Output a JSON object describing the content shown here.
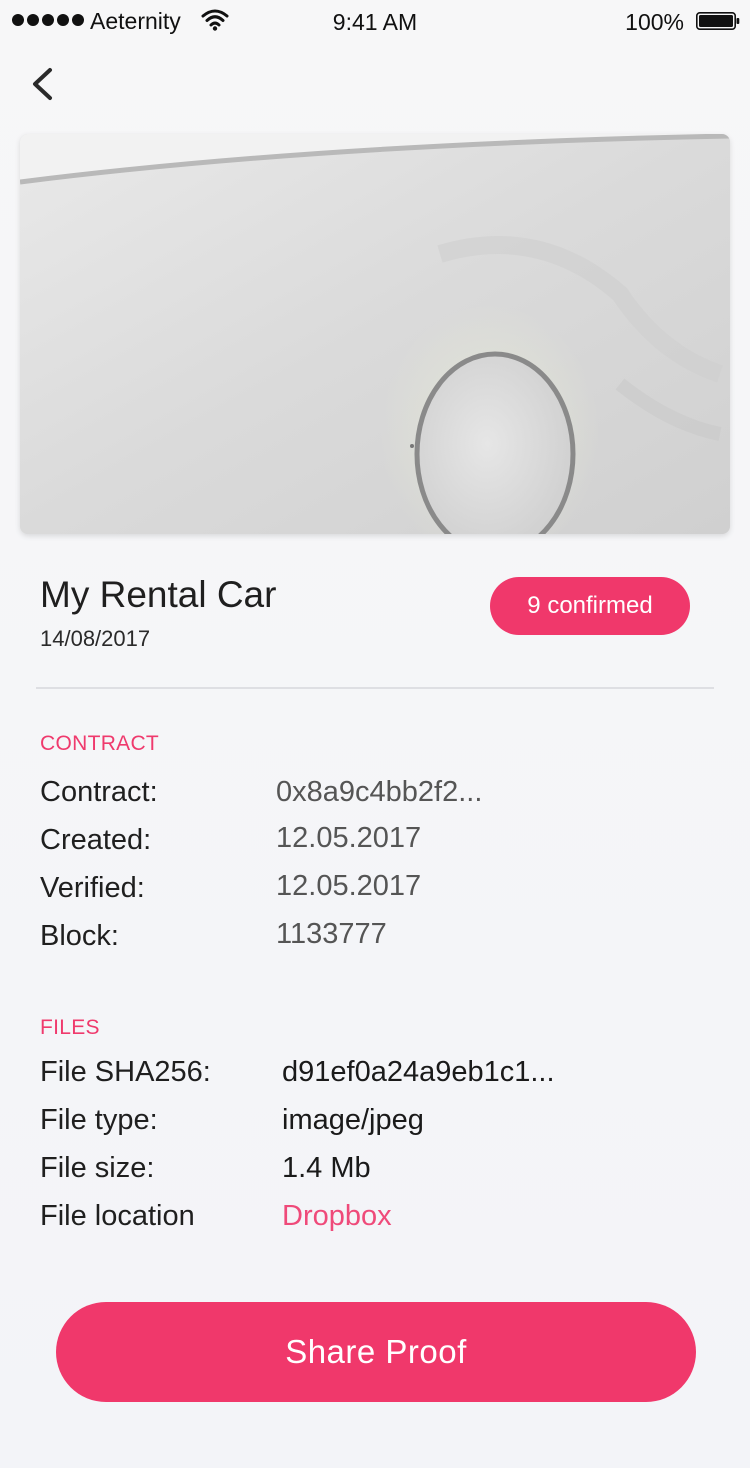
{
  "status_bar": {
    "carrier": "Aeternity",
    "time": "9:41 AM",
    "battery": "100%"
  },
  "icons": {
    "back": "chevron-left-icon",
    "wifi": "wifi-icon",
    "battery": "battery-icon",
    "signal": "signal-dots-icon"
  },
  "proof": {
    "title": "My Rental Car",
    "date": "14/08/2017",
    "badge": "9 confirmed"
  },
  "contract": {
    "heading": "CONTRACT",
    "rows": [
      {
        "label": "Contract:",
        "value": "0x8a9c4bb2f2..."
      },
      {
        "label": "Created:",
        "value": "12.05.2017"
      },
      {
        "label": "Verified:",
        "value": "12.05.2017"
      },
      {
        "label": "Block:",
        "value": "1133777"
      }
    ]
  },
  "files": {
    "heading": "FILES",
    "rows": [
      {
        "label": "File SHA256:",
        "value": "d91ef0a24a9eb1c1..."
      },
      {
        "label": "File type:",
        "value": "image/jpeg"
      },
      {
        "label": "File size:",
        "value": "1.4 Mb"
      },
      {
        "label": "File location",
        "value": "Dropbox"
      }
    ]
  },
  "share_button": "Share Proof",
  "colors": {
    "accent": "#f0386b",
    "link": "#ef4a7a",
    "background": "#f5f6f9"
  }
}
